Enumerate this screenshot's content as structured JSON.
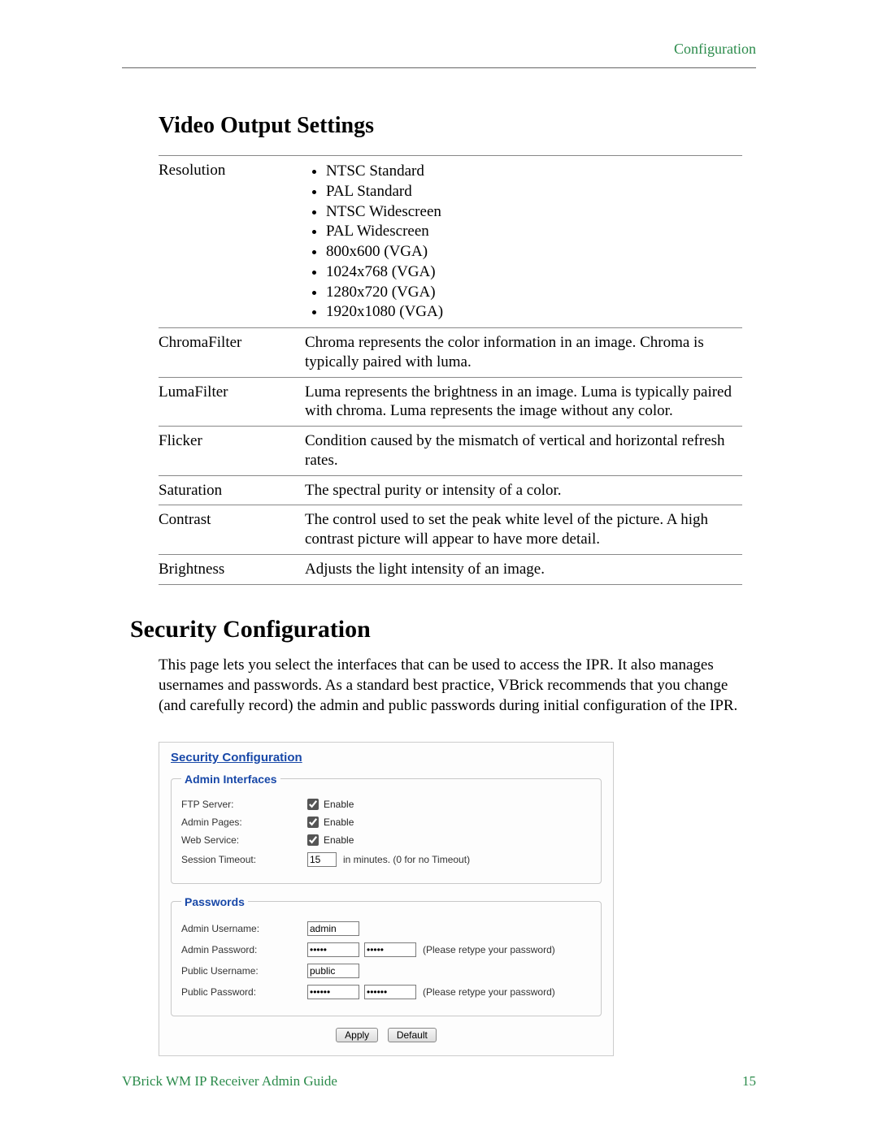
{
  "header": {
    "section": "Configuration"
  },
  "video_output": {
    "title": "Video Output Settings",
    "rows": {
      "resolution": {
        "label": "Resolution",
        "options": [
          "NTSC Standard",
          "PAL Standard",
          "NTSC Widescreen",
          "PAL Widescreen",
          "800x600 (VGA)",
          "1024x768 (VGA)",
          "1280x720 (VGA)",
          "1920x1080 (VGA)"
        ]
      },
      "chroma_filter": {
        "label": "ChromaFilter",
        "desc": "Chroma represents the color information in an image. Chroma is typically paired with luma."
      },
      "luma_filter": {
        "label": "LumaFilter",
        "desc": "Luma represents the brightness in an image. Luma is typically paired with chroma. Luma represents the image without any color."
      },
      "flicker": {
        "label": "Flicker",
        "desc": "Condition caused by the mismatch of vertical and horizontal refresh rates."
      },
      "saturation": {
        "label": "Saturation",
        "desc": "The spectral purity or intensity of a color."
      },
      "contrast": {
        "label": "Contrast",
        "desc": "The control used to set the peak white level of the picture. A high contrast picture will appear to have more detail."
      },
      "brightness": {
        "label": "Brightness",
        "desc": "Adjusts the light intensity of an image."
      }
    }
  },
  "security": {
    "title": "Security Configuration",
    "intro": "This page lets you select the interfaces that can be used to access the IPR. It also manages usernames and passwords. As a standard best practice, VBrick recommends that you change (and carefully record) the admin and public passwords during initial configuration of the IPR.",
    "panel_title": "Security Configuration",
    "admin_legend": "Admin Interfaces",
    "passwords_legend": "Passwords",
    "labels": {
      "ftp": "FTP Server:",
      "admin_pages": "Admin Pages:",
      "web_service": "Web Service:",
      "session_timeout": "Session Timeout:",
      "admin_user": "Admin Username:",
      "admin_pass": "Admin Password:",
      "public_user": "Public Username:",
      "public_pass": "Public Password:"
    },
    "enable_text": "Enable",
    "timeout_value": "15",
    "timeout_hint": "in minutes. (0 for no Timeout)",
    "admin_user_value": "admin",
    "public_user_value": "public",
    "admin_pass_value": "•••••",
    "admin_pass_confirm": "•••••",
    "public_pass_value": "••••••",
    "public_pass_confirm": "••••••",
    "retype_hint": "(Please retype your password)",
    "apply": "Apply",
    "default": "Default"
  },
  "footer": {
    "guide": "VBrick WM IP Receiver Admin Guide",
    "page": "15"
  }
}
